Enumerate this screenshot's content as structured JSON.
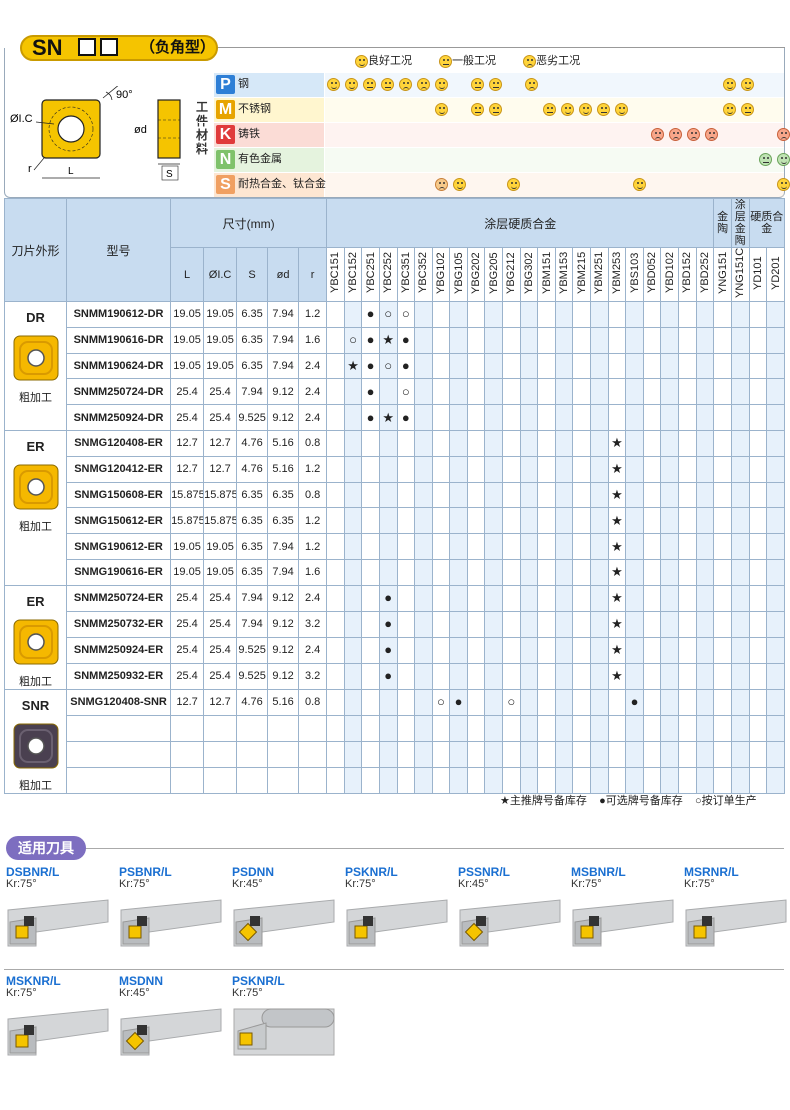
{
  "title": {
    "main": "SN",
    "sub": "（负角型）"
  },
  "legend": [
    {
      "icon": "happy-face-icon",
      "label": "良好工况"
    },
    {
      "icon": "neutral-face-icon",
      "label": "一般工况"
    },
    {
      "icon": "sad-face-icon",
      "label": "恶劣工况"
    }
  ],
  "diagram": {
    "angle": "90°",
    "ic": "ØI.C",
    "d": "ød",
    "r": "r",
    "L": "L",
    "S": "S"
  },
  "workpiece_label": "工件材料",
  "materials": [
    {
      "code": "P",
      "name": "钢",
      "color": "#2e7fd6",
      "bg": "#d6e8f8"
    },
    {
      "code": "M",
      "name": "不锈钢",
      "color": "#e7a400",
      "bg": "#fff6cf"
    },
    {
      "code": "K",
      "name": "铸铁",
      "color": "#e03b3b",
      "bg": "#fbdcd6"
    },
    {
      "code": "N",
      "name": "有色金属",
      "color": "#7fc26b",
      "bg": "#e5f3de"
    },
    {
      "code": "S",
      "name": "耐热合金、钛合金",
      "color": "#f0a062",
      "bg": "#fde6d2"
    }
  ],
  "headers": {
    "shape": "刀片外形",
    "model": "型号",
    "dims": "尺寸(mm)",
    "dim_cols": [
      "L",
      "ØI.C",
      "S",
      "ød",
      "r"
    ],
    "coated": "涂层硬质合金",
    "cermet": "金陶",
    "coated_cermet": "涂层金陶",
    "carbide": "硬质合金"
  },
  "grades": [
    "YBC151",
    "YBC152",
    "YBC251",
    "YBC252",
    "YBC351",
    "YBC352",
    "YBG102",
    "YBG105",
    "YBG202",
    "YBG205",
    "YBG212",
    "YBG302",
    "YBM151",
    "YBM153",
    "YBM215",
    "YBM251",
    "YBM253",
    "YBS103",
    "YBD052",
    "YBD102",
    "YBD152",
    "YBD252",
    "YNG151",
    "YNG151C",
    "YD101",
    "YD201"
  ],
  "shapes": [
    {
      "name": "DR",
      "note": "粗加工",
      "icon": "insert-dr-icon",
      "rows": 5
    },
    {
      "name": "ER",
      "note": "粗加工",
      "icon": "insert-er-icon",
      "rows": 6
    },
    {
      "name": "ER",
      "note": "粗加工",
      "icon": "insert-er2-icon",
      "rows": 4
    },
    {
      "name": "SNR",
      "note": "粗加工",
      "icon": "insert-snr-icon",
      "rows": 4
    }
  ],
  "rows": [
    {
      "model": "SNMM190612-DR",
      "L": "19.05",
      "IC": "19.05",
      "S": "6.35",
      "d": "7.94",
      "r": "1.2",
      "marks": {
        "2": "●",
        "3": "○",
        "4": "○"
      }
    },
    {
      "model": "SNMM190616-DR",
      "L": "19.05",
      "IC": "19.05",
      "S": "6.35",
      "d": "7.94",
      "r": "1.6",
      "marks": {
        "1": "○",
        "2": "●",
        "3": "★",
        "4": "●"
      }
    },
    {
      "model": "SNMM190624-DR",
      "L": "19.05",
      "IC": "19.05",
      "S": "6.35",
      "d": "7.94",
      "r": "2.4",
      "marks": {
        "1": "★",
        "2": "●",
        "3": "○",
        "4": "●"
      }
    },
    {
      "model": "SNMM250724-DR",
      "L": "25.4",
      "IC": "25.4",
      "S": "7.94",
      "d": "9.12",
      "r": "2.4",
      "marks": {
        "2": "●",
        "4": "○"
      }
    },
    {
      "model": "SNMM250924-DR",
      "L": "25.4",
      "IC": "25.4",
      "S": "9.525",
      "d": "9.12",
      "r": "2.4",
      "marks": {
        "2": "●",
        "3": "★",
        "4": "●"
      }
    },
    {
      "model": "SNMG120408-ER",
      "L": "12.7",
      "IC": "12.7",
      "S": "4.76",
      "d": "5.16",
      "r": "0.8",
      "marks": {
        "16": "★"
      }
    },
    {
      "model": "SNMG120412-ER",
      "L": "12.7",
      "IC": "12.7",
      "S": "4.76",
      "d": "5.16",
      "r": "1.2",
      "marks": {
        "16": "★"
      }
    },
    {
      "model": "SNMG150608-ER",
      "L": "15.875",
      "IC": "15.875",
      "S": "6.35",
      "d": "6.35",
      "r": "0.8",
      "marks": {
        "16": "★"
      }
    },
    {
      "model": "SNMG150612-ER",
      "L": "15.875",
      "IC": "15.875",
      "S": "6.35",
      "d": "6.35",
      "r": "1.2",
      "marks": {
        "16": "★"
      }
    },
    {
      "model": "SNMG190612-ER",
      "L": "19.05",
      "IC": "19.05",
      "S": "6.35",
      "d": "7.94",
      "r": "1.2",
      "marks": {
        "16": "★"
      }
    },
    {
      "model": "SNMG190616-ER",
      "L": "19.05",
      "IC": "19.05",
      "S": "6.35",
      "d": "7.94",
      "r": "1.6",
      "marks": {
        "16": "★"
      }
    },
    {
      "model": "SNMM250724-ER",
      "L": "25.4",
      "IC": "25.4",
      "S": "7.94",
      "d": "9.12",
      "r": "2.4",
      "marks": {
        "3": "●",
        "16": "★"
      }
    },
    {
      "model": "SNMM250732-ER",
      "L": "25.4",
      "IC": "25.4",
      "S": "7.94",
      "d": "9.12",
      "r": "3.2",
      "marks": {
        "3": "●",
        "16": "★"
      }
    },
    {
      "model": "SNMM250924-ER",
      "L": "25.4",
      "IC": "25.4",
      "S": "9.525",
      "d": "9.12",
      "r": "2.4",
      "marks": {
        "3": "●",
        "16": "★"
      }
    },
    {
      "model": "SNMM250932-ER",
      "L": "25.4",
      "IC": "25.4",
      "S": "9.525",
      "d": "9.12",
      "r": "3.2",
      "marks": {
        "3": "●",
        "16": "★"
      }
    },
    {
      "model": "SNMG120408-SNR",
      "L": "12.7",
      "IC": "12.7",
      "S": "4.76",
      "d": "5.16",
      "r": "0.8",
      "marks": {
        "6": "○",
        "7": "●",
        "10": "○",
        "17": "●"
      }
    },
    {
      "model": "",
      "L": "",
      "IC": "",
      "S": "",
      "d": "",
      "r": "",
      "marks": {}
    },
    {
      "model": "",
      "L": "",
      "IC": "",
      "S": "",
      "d": "",
      "r": "",
      "marks": {}
    },
    {
      "model": "",
      "L": "",
      "IC": "",
      "S": "",
      "d": "",
      "r": "",
      "marks": {}
    }
  ],
  "material_faces": {
    "P": {
      "0": "happy",
      "1": "happy",
      "2": "neutral",
      "3": "neutral",
      "4": "sad",
      "5": "sad",
      "6": "happy",
      "8": "neutral",
      "9": "neutral",
      "11": "sad",
      "22": "happy",
      "23": "happy"
    },
    "M": {
      "6": "happy",
      "8": "neutral",
      "9": "neutral",
      "12": "neutral",
      "13": "happy",
      "14": "happy",
      "15": "neutral",
      "16": "happy",
      "22": "happy",
      "23": "neutral"
    },
    "K": {
      "18": "bad",
      "19": "bad",
      "20": "bad",
      "21": "bad",
      "25": "bad"
    },
    "N": {
      "24": "green-neutral",
      "25": "green"
    },
    "S": {
      "6": "sad-y",
      "7": "happy",
      "10": "happy",
      "17": "happy",
      "25": "happy"
    }
  },
  "footnote": {
    "star": "★主推牌号备库存",
    "dot": "●可选牌号备库存",
    "circle": "○按订单生产"
  },
  "tools_title": "适用刀具",
  "tools": [
    {
      "name": "DSBNR/L",
      "kr": "Kr:75°"
    },
    {
      "name": "PSBNR/L",
      "kr": "Kr:75°"
    },
    {
      "name": "PSDNN",
      "kr": "Kr:45°"
    },
    {
      "name": "PSKNR/L",
      "kr": "Kr:75°"
    },
    {
      "name": "PSSNR/L",
      "kr": "Kr:45°"
    },
    {
      "name": "MSBNR/L",
      "kr": "Kr:75°"
    },
    {
      "name": "MSRNR/L",
      "kr": "Kr:75°"
    },
    {
      "name": "MSKNR/L",
      "kr": "Kr:75°"
    },
    {
      "name": "MSDNN",
      "kr": "Kr:45°"
    },
    {
      "name": "PSKNR/L",
      "kr": "Kr:75°"
    }
  ]
}
